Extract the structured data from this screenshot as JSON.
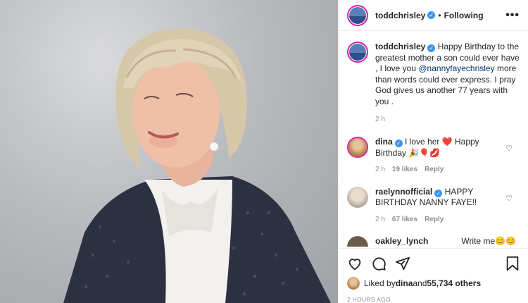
{
  "photo": {
    "alt_subject": "portrait-photo"
  },
  "header": {
    "username": "toddchrisley",
    "separator": "•",
    "follow_status": "Following",
    "more": "•••"
  },
  "caption": {
    "username": "toddchrisley",
    "text_before": " Happy Birthday to the greatest mother a son could ever have , I love you ",
    "mention": "@nannyfayechrisley",
    "text_after": " more than words could ever express. I pray God gives us another 77 years with you .",
    "time": "2 h"
  },
  "comments": [
    {
      "username": "dina",
      "text": " I love her ❤️ Happy Birthday 🎉🎈💋",
      "time": "2 h",
      "likes": "19 likes",
      "reply": "Reply"
    },
    {
      "username": "raelynnofficial",
      "text": " HAPPY BIRTHDAY NANNY FAYE!!",
      "time": "2 h",
      "likes": "67 likes",
      "reply": "Reply"
    },
    {
      "username": "oakley_lynch",
      "text": "Write me😊😊"
    }
  ],
  "likes": {
    "prefix": "Liked by ",
    "user": "dina",
    "middle": " and ",
    "count": "55,734 others"
  },
  "posted_ago": "2 HOURS AGO",
  "colors": {
    "verified": "#3897f0",
    "mention": "#00376b",
    "muted": "#8e8e8e"
  }
}
